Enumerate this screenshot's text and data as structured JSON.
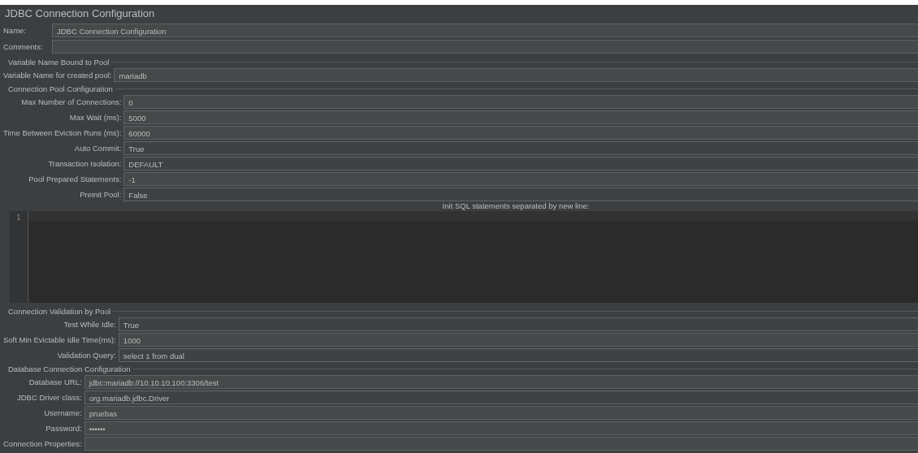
{
  "title": "JDBC Connection Configuration",
  "name": {
    "label": "Name:",
    "value": "JDBC Connection Configuration"
  },
  "comments": {
    "label": "Comments:"
  },
  "groups_top": [
    {
      "title": "Variable Name Bound to Pool",
      "fields": [
        {
          "label": "Variable Name for created pool:",
          "value": "mariadb",
          "kind": "text"
        }
      ]
    },
    {
      "title": "Connection Pool Configuration",
      "fields": [
        {
          "label": "Max Number of Connections:",
          "value": "0",
          "kind": "text"
        },
        {
          "label": "Max Wait (ms):",
          "value": "5000",
          "kind": "text"
        },
        {
          "label": "Time Between Eviction Runs (ms):",
          "value": "60000",
          "kind": "text"
        },
        {
          "label": "Auto Commit:",
          "value": "True",
          "kind": "combo"
        },
        {
          "label": "Transaction Isolation:",
          "value": "DEFAULT",
          "kind": "combo"
        },
        {
          "label": "Pool Prepared Statements:",
          "value": "-1",
          "kind": "text"
        },
        {
          "label": "Preinit Pool:",
          "value": "False",
          "kind": "combo"
        }
      ]
    }
  ],
  "init_sql": {
    "label": "Init SQL statements separated by new line:",
    "line_numbers": [
      "1"
    ]
  },
  "groups_bottom": [
    {
      "title": "Connection Validation by Pool",
      "fields": [
        {
          "label": "Test While Idle:",
          "value": "True",
          "kind": "combo"
        },
        {
          "label": "Soft Min Evictable Idle Time(ms):",
          "value": "1000",
          "kind": "text"
        },
        {
          "label": "Validation Query:",
          "value": "select 1 from dual",
          "kind": "combo"
        }
      ]
    },
    {
      "title": "Database Connection Configuration",
      "fields": [
        {
          "label": "Database URL:",
          "value": "jdbc:mariadb://10.10.10.100:3306/test",
          "kind": "text"
        },
        {
          "label": "JDBC Driver class:",
          "value": "org.mariadb.jdbc.Driver",
          "kind": "combo"
        },
        {
          "label": "Username:",
          "value": "pruebas",
          "kind": "text"
        },
        {
          "label": "Password:",
          "value": "••••••",
          "kind": "text"
        },
        {
          "label": "Connection Properties:",
          "kind": "text"
        }
      ]
    }
  ]
}
